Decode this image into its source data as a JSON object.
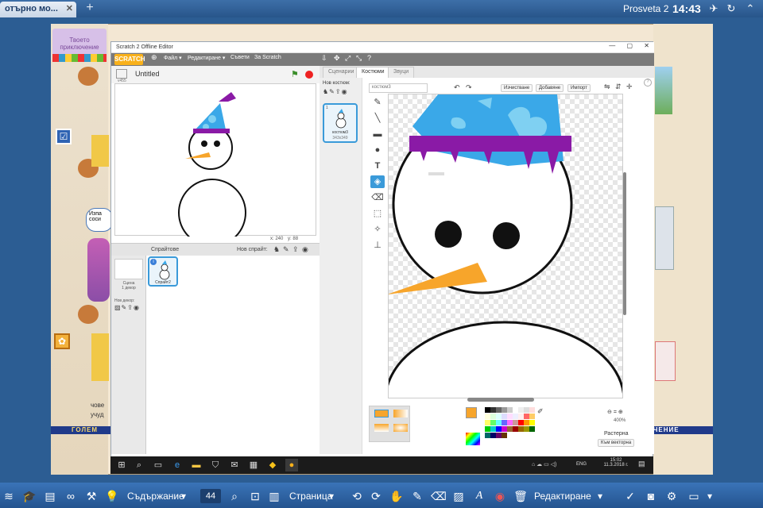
{
  "host": {
    "tab_title": "отърно мо...",
    "new_tab": "+",
    "brand": "Prosveta 2",
    "time": "14:43"
  },
  "book": {
    "header": "Твоето\nприключение",
    "band_left": "ГОЛЕМ",
    "band_right": "ЛЮЧЕНИЕ",
    "left_text_1": "чове",
    "left_text_2": "учуд",
    "speech": "Изпа\nсоси"
  },
  "window": {
    "title": "Scratch 2 Offline Editor",
    "logo": "SCRATCH",
    "menus": [
      "Файл ▾",
      "Редактиране ▾",
      "Съвети",
      "За Scratch"
    ]
  },
  "stage": {
    "project_title": "Untitled",
    "version": "v455",
    "coords_x": "x: 240",
    "coords_y": "y: 88"
  },
  "sprites": {
    "header": "Спрайтове",
    "new_sprite": "Нов спрайт:",
    "stage_label": "Сцена\n1 декор",
    "new_backdrop": "Нов декор:",
    "sprite_name": "Спрайт2",
    "sprite_badge": "i"
  },
  "tabs": {
    "scripts": "Сценарии",
    "costumes": "Костюми",
    "sounds": "Звуци"
  },
  "costumes": {
    "new_costume": "Нов костюм:",
    "item_index": "1",
    "item_name": "костюм3",
    "item_size": "343x349"
  },
  "paint": {
    "name_value": "костюм3",
    "clear": "Изчистване",
    "add": "Добавяне",
    "import": "Импорт",
    "zoom": "400%",
    "mode": "Растерна",
    "convert": "Към векторна"
  },
  "taskbar": {
    "lang": "ENG",
    "time": "15:02",
    "date": "11.3.2018 г."
  },
  "bottom": {
    "contents": "Съдържание",
    "page": "44",
    "page_label": "Страница",
    "edit": "Редактиране"
  },
  "colors": {
    "hat_blue": "#3aa8e8",
    "hat_light": "#7fd0f2",
    "pompom_purple": "#8a1aa6",
    "nose_orange": "#f7a52b",
    "scratch_orange": "#f9b11b"
  }
}
